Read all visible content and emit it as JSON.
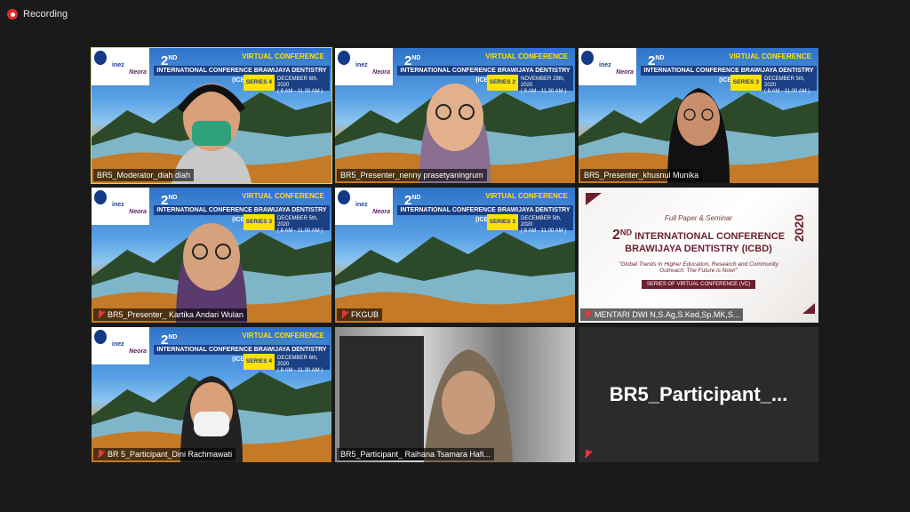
{
  "recording": {
    "label": "Recording"
  },
  "banner": {
    "logo_inez": "inez",
    "logo_neora": "Neora",
    "virtual_conference": "VIRTUAL CONFERENCE",
    "ordinal": "2",
    "ordinal_suffix": "ND",
    "conference_title": "INTERNATIONAL CONFERENCE BRAWIJAYA DENTISTRY (ICBD)"
  },
  "tiles": [
    {
      "name": "BR5_Moderator_diah diah",
      "series": "SERIES 4",
      "date": "DECEMBER 6th, 2020",
      "time": "( 8 AM - 11.30 AM )",
      "muted": false,
      "active": true
    },
    {
      "name": "BR5_Presenter_nenny prasetyaningrum",
      "series": "SERIES 2",
      "date": "NOVEMBER 29th, 2020",
      "time": "( 8 AM - 11.30 AM )",
      "muted": false,
      "active": false
    },
    {
      "name": "BR5_Presenter_khusnul Munika",
      "series": "SERIES 3",
      "date": "DECEMBER 5th, 2020",
      "time": "( 8 AM - 11.00 AM )",
      "muted": false,
      "active": false
    },
    {
      "name": "BR5_Presenter_ Kartika Andari Wulan",
      "series": "SERIES 3",
      "date": "DECEMBER 5th, 2020",
      "time": "( 8 AM - 11.00 AM )",
      "muted": true,
      "active": false
    },
    {
      "name": "FKGUB",
      "series": "SERIES 3",
      "date": "DECEMBER 5th, 2020",
      "time": "( 8 AM - 11.00 AM )",
      "muted": true,
      "active": false
    },
    {
      "name": "MENTARI DWI N,S.Ag,S.Ked,Sp.MK,S...",
      "muted": true,
      "active": false
    },
    {
      "name": "BR 5_Participant_Dini Rachmawati",
      "series": "SERIES 4",
      "date": "DECEMBER 6th, 2020",
      "time": "( 8 AM - 11.30 AM )",
      "muted": true,
      "active": false
    },
    {
      "name": "BR5_Participant_ Raihana Tsamara Hafi...",
      "muted": false,
      "active": false
    },
    {
      "name": "",
      "display_name": "BR5_Participant_...",
      "muted": true,
      "active": false
    }
  ],
  "poster": {
    "line1": "Full Paper & Seminar",
    "ordinal": "2",
    "ordinal_suffix": "ND",
    "line2a": "INTERNATIONAL CONFERENCE",
    "line2b": "BRAWIJAYA DENTISTRY (ICBD)",
    "year": "2020",
    "theme": "\"Global Trends in Higher Education, Research and Community Outreach: The Future is Now!\"",
    "series": "SERIES OF VIRTUAL CONFERENCE (VC)"
  },
  "colors": {
    "active_border": "#c9e24b",
    "muted_icon": "#e23a3a",
    "banner_navy": "#1b3f84",
    "banner_yellow": "#ffe200"
  }
}
